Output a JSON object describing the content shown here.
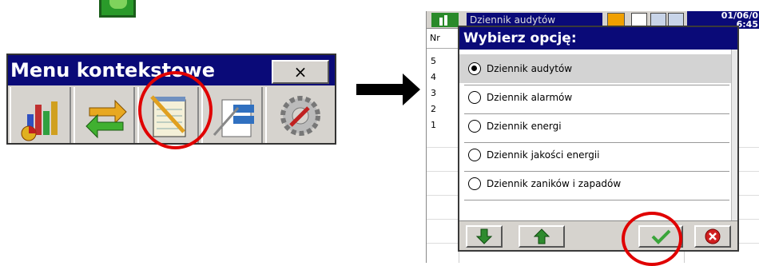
{
  "context_menu": {
    "title": "Menu kontekstowe",
    "close_label": "×",
    "buttons": [
      "chart-icon",
      "refresh-arrows-icon",
      "notepad-pencil-icon",
      "edit-form-icon",
      "gear-tools-icon"
    ]
  },
  "background_window": {
    "title": "Dziennik audytów",
    "date": "01/06/0",
    "time": "6:45",
    "column_header": "Nr",
    "rows": [
      "5",
      "4",
      "3",
      "2",
      "1"
    ]
  },
  "dialog": {
    "title": "Wybierz opcję:",
    "options": [
      {
        "label": "Dziennik audytów",
        "selected": true
      },
      {
        "label": "Dziennik alarmów",
        "selected": false
      },
      {
        "label": "Dziennik energi",
        "selected": false
      },
      {
        "label": "Dziennik jakości energii",
        "selected": false
      },
      {
        "label": "Dziennik zaników i zapadów",
        "selected": false
      }
    ],
    "footer_buttons": [
      "arrow-down-icon",
      "arrow-up-icon",
      "checkmark-icon",
      "cancel-icon"
    ]
  },
  "colors": {
    "title_bar": "#0a0a78",
    "panel": "#d6d3ce",
    "highlight": "#e00000",
    "confirm_green": "#3aa53a"
  }
}
